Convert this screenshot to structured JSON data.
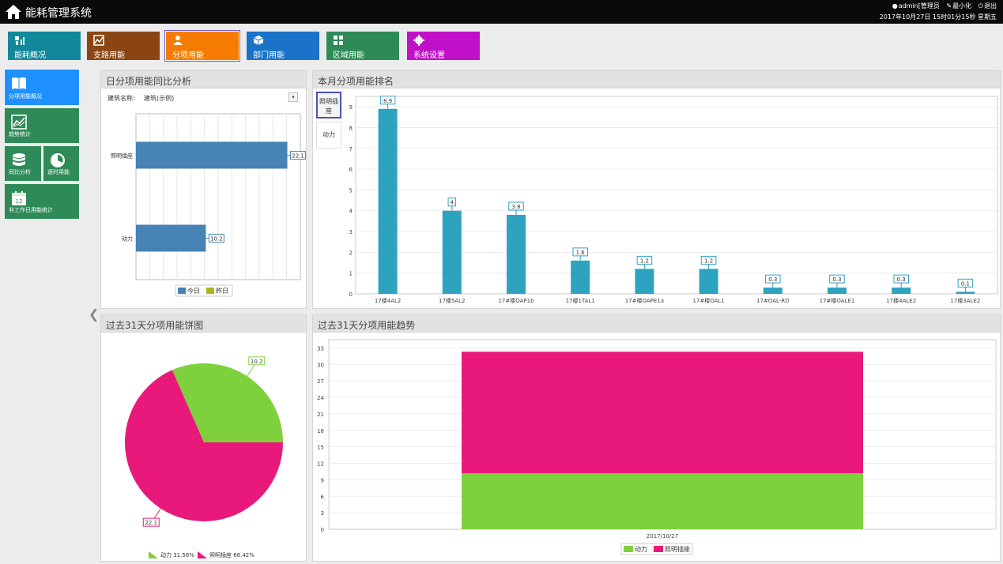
{
  "app": {
    "title": "能耗管理系统",
    "user": "admin[管理员",
    "minimize": "最小化",
    "logout": "退出",
    "datetime": "2017年10月27日 15时01分15秒 星期五"
  },
  "modules": [
    {
      "label": "能耗概况",
      "icon": "bar-chart-icon",
      "color": "#13889a"
    },
    {
      "label": "支路用能",
      "icon": "line-chart-icon",
      "color": "#8b4513"
    },
    {
      "label": "分项用能",
      "icon": "user-icon",
      "color": "#f57c00"
    },
    {
      "label": "部门用能",
      "icon": "cube-icon",
      "color": "#1a73c8"
    },
    {
      "label": "区域用能",
      "icon": "grid-icon",
      "color": "#2e8b57"
    },
    {
      "label": "系统设置",
      "icon": "gear-icon",
      "color": "#c010c8"
    }
  ],
  "sidenav": [
    {
      "label": "分项用能概况",
      "icon": "book-icon",
      "color": "#1e90ff"
    },
    {
      "label": "趋势统计",
      "icon": "trend-icon",
      "color": "#2e8b57"
    },
    {
      "label": "同比分析",
      "icon": "database-icon",
      "color": "#2e8b57"
    },
    {
      "label": "逐时用能",
      "icon": "clock-icon",
      "color": "#2e8b57"
    },
    {
      "label": "非工作日用能统计",
      "icon": "calendar-icon",
      "color": "#2e8b57"
    }
  ],
  "calendar_day": "12",
  "panels": {
    "daily": {
      "title": "日分项用能同比分析",
      "building_label": "建筑名称:",
      "building_value": "建筑(示例)"
    },
    "ranking": {
      "title": "本月分项用能排名",
      "tabs": [
        "照明插座",
        "动力"
      ]
    },
    "pie": {
      "title": "过去31天分项用能饼图"
    },
    "trend": {
      "title": "过去31天分项用能趋势"
    }
  },
  "chart_data": [
    {
      "type": "bar",
      "orientation": "horizontal",
      "categories": [
        "照明插座",
        "动力"
      ],
      "series": [
        {
          "name": "今日",
          "color": "#4682b4",
          "values": [
            22.1,
            10.2
          ]
        },
        {
          "name": "昨日",
          "color": "#a8b820",
          "values": [
            null,
            null
          ]
        }
      ],
      "data_labels": [
        "22.1",
        "10.2"
      ],
      "xlim": [
        0,
        24
      ],
      "grid": true,
      "legend": "bottom"
    },
    {
      "type": "bar",
      "categories": [
        "17楼4AL2",
        "17楼5AL2",
        "17#楼OAP1b",
        "17楼1TAL1",
        "17#楼OAPE1a",
        "17#楼OAL1",
        "17#OAL-RD",
        "17#楼OALE1",
        "17楼4ALE2",
        "17楼3ALE2"
      ],
      "values": [
        8.9,
        4,
        3.8,
        1.6,
        1.2,
        1.2,
        0.3,
        0.3,
        0.3,
        0.1
      ],
      "data_labels": [
        "8.9",
        "4",
        "3.8",
        "1.6",
        "1.2",
        "1.2",
        "0.3",
        "0.3",
        "0.3",
        "0.1"
      ],
      "yticks": [
        "0",
        "1",
        "2",
        "3",
        "4",
        "5",
        "6",
        "7",
        "8",
        "9"
      ],
      "ylim": [
        0,
        9.5
      ],
      "color": "#2ea3c0",
      "grid": true
    },
    {
      "type": "pie",
      "slices": [
        {
          "name": "动力",
          "value": 10.2,
          "label": "10.2",
          "percent": "31.58%",
          "color": "#7ed13c"
        },
        {
          "name": "照明插座",
          "value": 22.1,
          "label": "22.1",
          "percent": "68.42%",
          "color": "#e8197a"
        }
      ],
      "legend": "bottom"
    },
    {
      "type": "bar",
      "stacked": true,
      "categories": [
        "2017/10/27"
      ],
      "series": [
        {
          "name": "动力",
          "color": "#7ed13c",
          "values": [
            10.2
          ]
        },
        {
          "name": "照明插座",
          "color": "#e8197a",
          "values": [
            22.1
          ]
        }
      ],
      "yticks": [
        "0",
        "3",
        "6",
        "9",
        "12",
        "15",
        "18",
        "21",
        "24",
        "27",
        "30",
        "33"
      ],
      "ylim": [
        0,
        34.5
      ],
      "grid": true,
      "legend": "bottom"
    }
  ]
}
